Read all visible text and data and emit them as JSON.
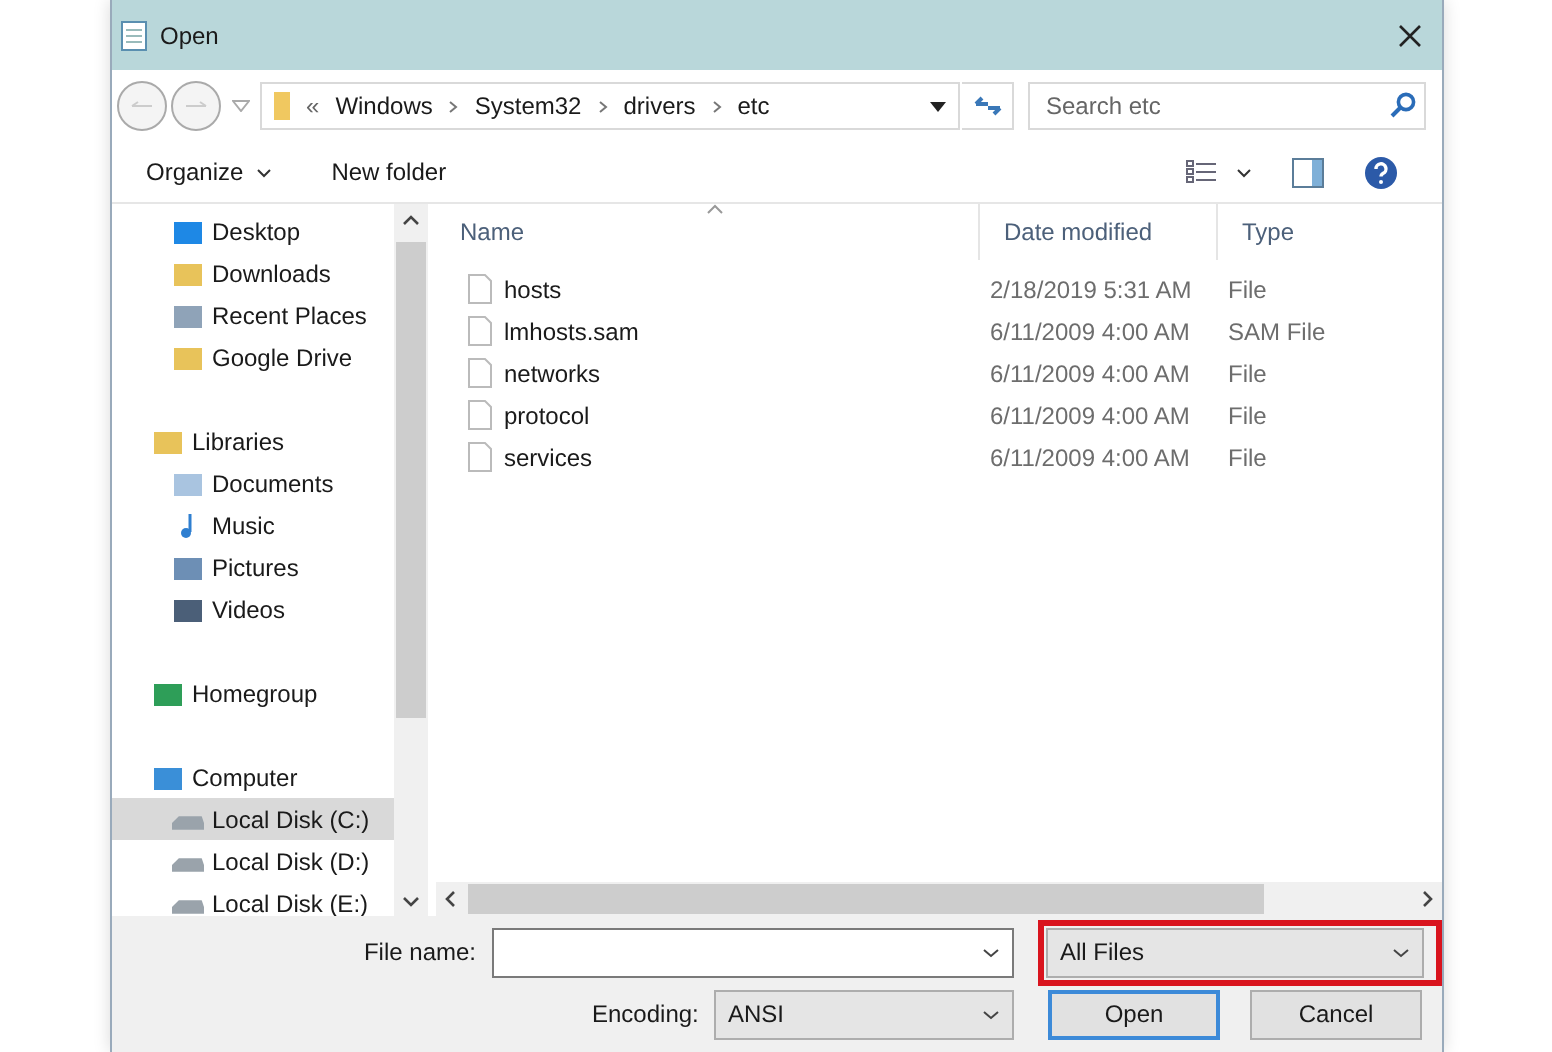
{
  "window": {
    "title": "Open"
  },
  "address_bar": {
    "overflow": "«",
    "path": [
      "Windows",
      "System32",
      "drivers",
      "etc"
    ]
  },
  "search": {
    "placeholder": "Search etc"
  },
  "toolbar": {
    "organize": "Organize",
    "new_folder": "New folder"
  },
  "sidebar": {
    "tree": [
      {
        "children": [
          {
            "label": "Desktop",
            "kind": "desktop",
            "selected": false
          },
          {
            "label": "Downloads",
            "kind": "downloads",
            "selected": false
          },
          {
            "label": "Recent Places",
            "kind": "recent",
            "selected": false
          },
          {
            "label": "Google Drive",
            "kind": "drive",
            "selected": false
          }
        ]
      },
      {
        "label": "Libraries",
        "kind": "libraries",
        "selected": false,
        "children": [
          {
            "label": "Documents",
            "kind": "documents",
            "selected": false
          },
          {
            "label": "Music",
            "kind": "music",
            "selected": false
          },
          {
            "label": "Pictures",
            "kind": "pictures",
            "selected": false
          },
          {
            "label": "Videos",
            "kind": "videos",
            "selected": false
          }
        ]
      },
      {
        "label": "Homegroup",
        "kind": "homegroup",
        "selected": false
      },
      {
        "label": "Computer",
        "kind": "computer",
        "selected": false,
        "children": [
          {
            "label": "Local Disk (C:)",
            "kind": "disk",
            "selected": true
          },
          {
            "label": "Local Disk (D:)",
            "kind": "disk",
            "selected": false
          },
          {
            "label": "Local Disk (E:)",
            "kind": "disk",
            "selected": false
          }
        ]
      }
    ]
  },
  "table": {
    "columns": [
      "Name",
      "Date modified",
      "Type"
    ],
    "rows": [
      [
        "hosts",
        "2/18/2019 5:31 AM",
        "File"
      ],
      [
        "lmhosts.sam",
        "6/11/2009 4:00 AM",
        "SAM File"
      ],
      [
        "networks",
        "6/11/2009 4:00 AM",
        "File"
      ],
      [
        "protocol",
        "6/11/2009 4:00 AM",
        "File"
      ],
      [
        "services",
        "6/11/2009 4:00 AM",
        "File"
      ]
    ]
  },
  "file_name": {
    "label": "File name:"
  },
  "file_type": {
    "value": "All Files",
    "highlighted": true
  },
  "encoding": {
    "label": "Encoding:",
    "value": "ANSI"
  },
  "buttons": [
    "Open",
    "Cancel"
  ]
}
